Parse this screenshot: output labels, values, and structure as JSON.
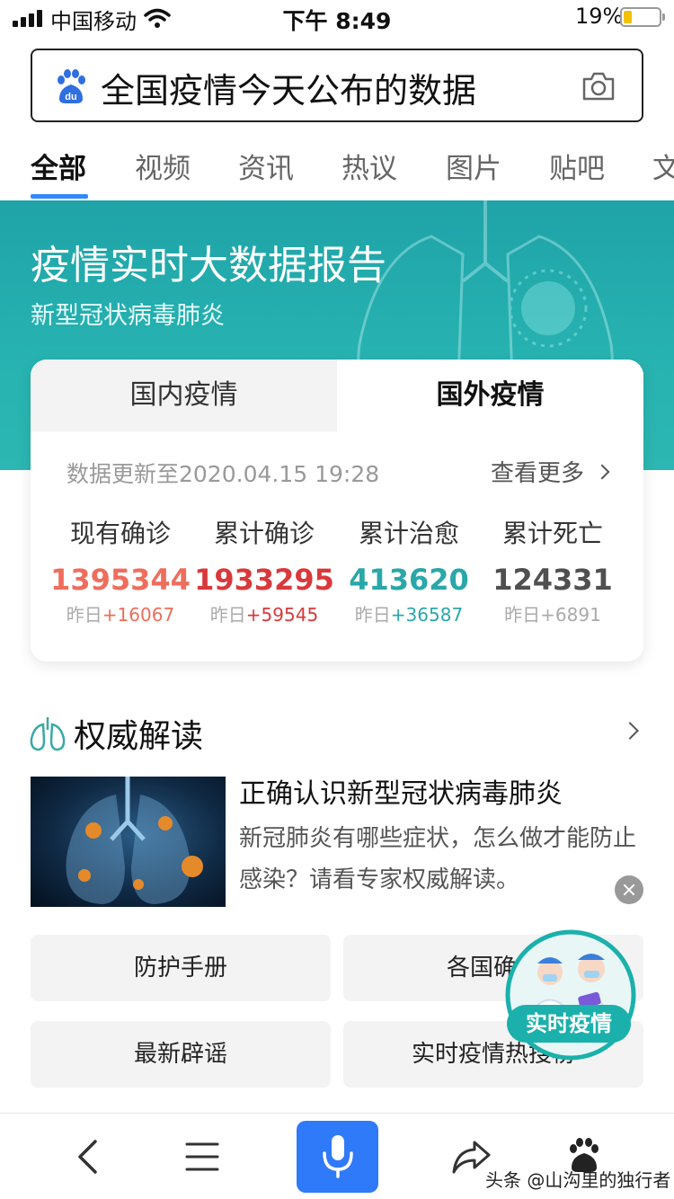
{
  "status_bar": {
    "carrier": "中国移动",
    "time": "下午 8:49",
    "battery_percent": "19%",
    "battery_level": 0.19,
    "icons": [
      "signal-icon",
      "wifi-icon",
      "battery-icon"
    ]
  },
  "search": {
    "query": "全国疫情今天公布的数据",
    "icons": [
      "baidu-paw-icon",
      "camera-icon"
    ]
  },
  "tabs": [
    {
      "label": "全部",
      "active": true
    },
    {
      "label": "视频",
      "active": false
    },
    {
      "label": "资讯",
      "active": false
    },
    {
      "label": "热议",
      "active": false
    },
    {
      "label": "图片",
      "active": false
    },
    {
      "label": "贴吧",
      "active": false
    },
    {
      "label": "文",
      "active": false
    }
  ],
  "banner": {
    "title": "疫情实时大数据报告",
    "subtitle": "新型冠状病毒肺炎"
  },
  "data_card": {
    "tab_domestic": "国内疫情",
    "tab_foreign": "国外疫情",
    "active_tab": "国外疫情",
    "update_text": "数据更新至2020.04.15 19:28",
    "more_label": "查看更多",
    "stats": [
      {
        "label": "现有确诊",
        "value": "1395344",
        "delta_prefix": "昨日",
        "delta": "+16067",
        "color": "#ef6d5c"
      },
      {
        "label": "累计确诊",
        "value": "1933295",
        "delta_prefix": "昨日",
        "delta": "+59545",
        "color": "#d9393b"
      },
      {
        "label": "累计治愈",
        "value": "413620",
        "delta_prefix": "昨日",
        "delta": "+36587",
        "color": "#2aa7a8"
      },
      {
        "label": "累计死亡",
        "value": "124331",
        "delta_prefix": "昨日",
        "delta": "+6891",
        "color": "#505050"
      }
    ]
  },
  "section": {
    "title": "权威解读",
    "icon": "lungs-icon"
  },
  "article": {
    "title": "正确认识新型冠状病毒肺炎",
    "description": "新冠肺炎有哪些症状，怎么做才能防止感染？请看专家权威解读。"
  },
  "quick_buttons": [
    {
      "label": "防护手册"
    },
    {
      "label": "各国确诊"
    },
    {
      "label": "最新辟谣"
    },
    {
      "label": "实时疫情热搜榜"
    }
  ],
  "float_badge": {
    "label": "实时疫情"
  },
  "bottom_bar": {
    "icons": [
      "back-icon",
      "menu-icon",
      "mic-icon",
      "share-icon",
      "baidu-home-icon"
    ],
    "watermark": "头条 @山沟里的独行者"
  },
  "colors": {
    "banner": "#27b3b1",
    "accent": "#3388ff",
    "mic": "#2f7af8"
  }
}
